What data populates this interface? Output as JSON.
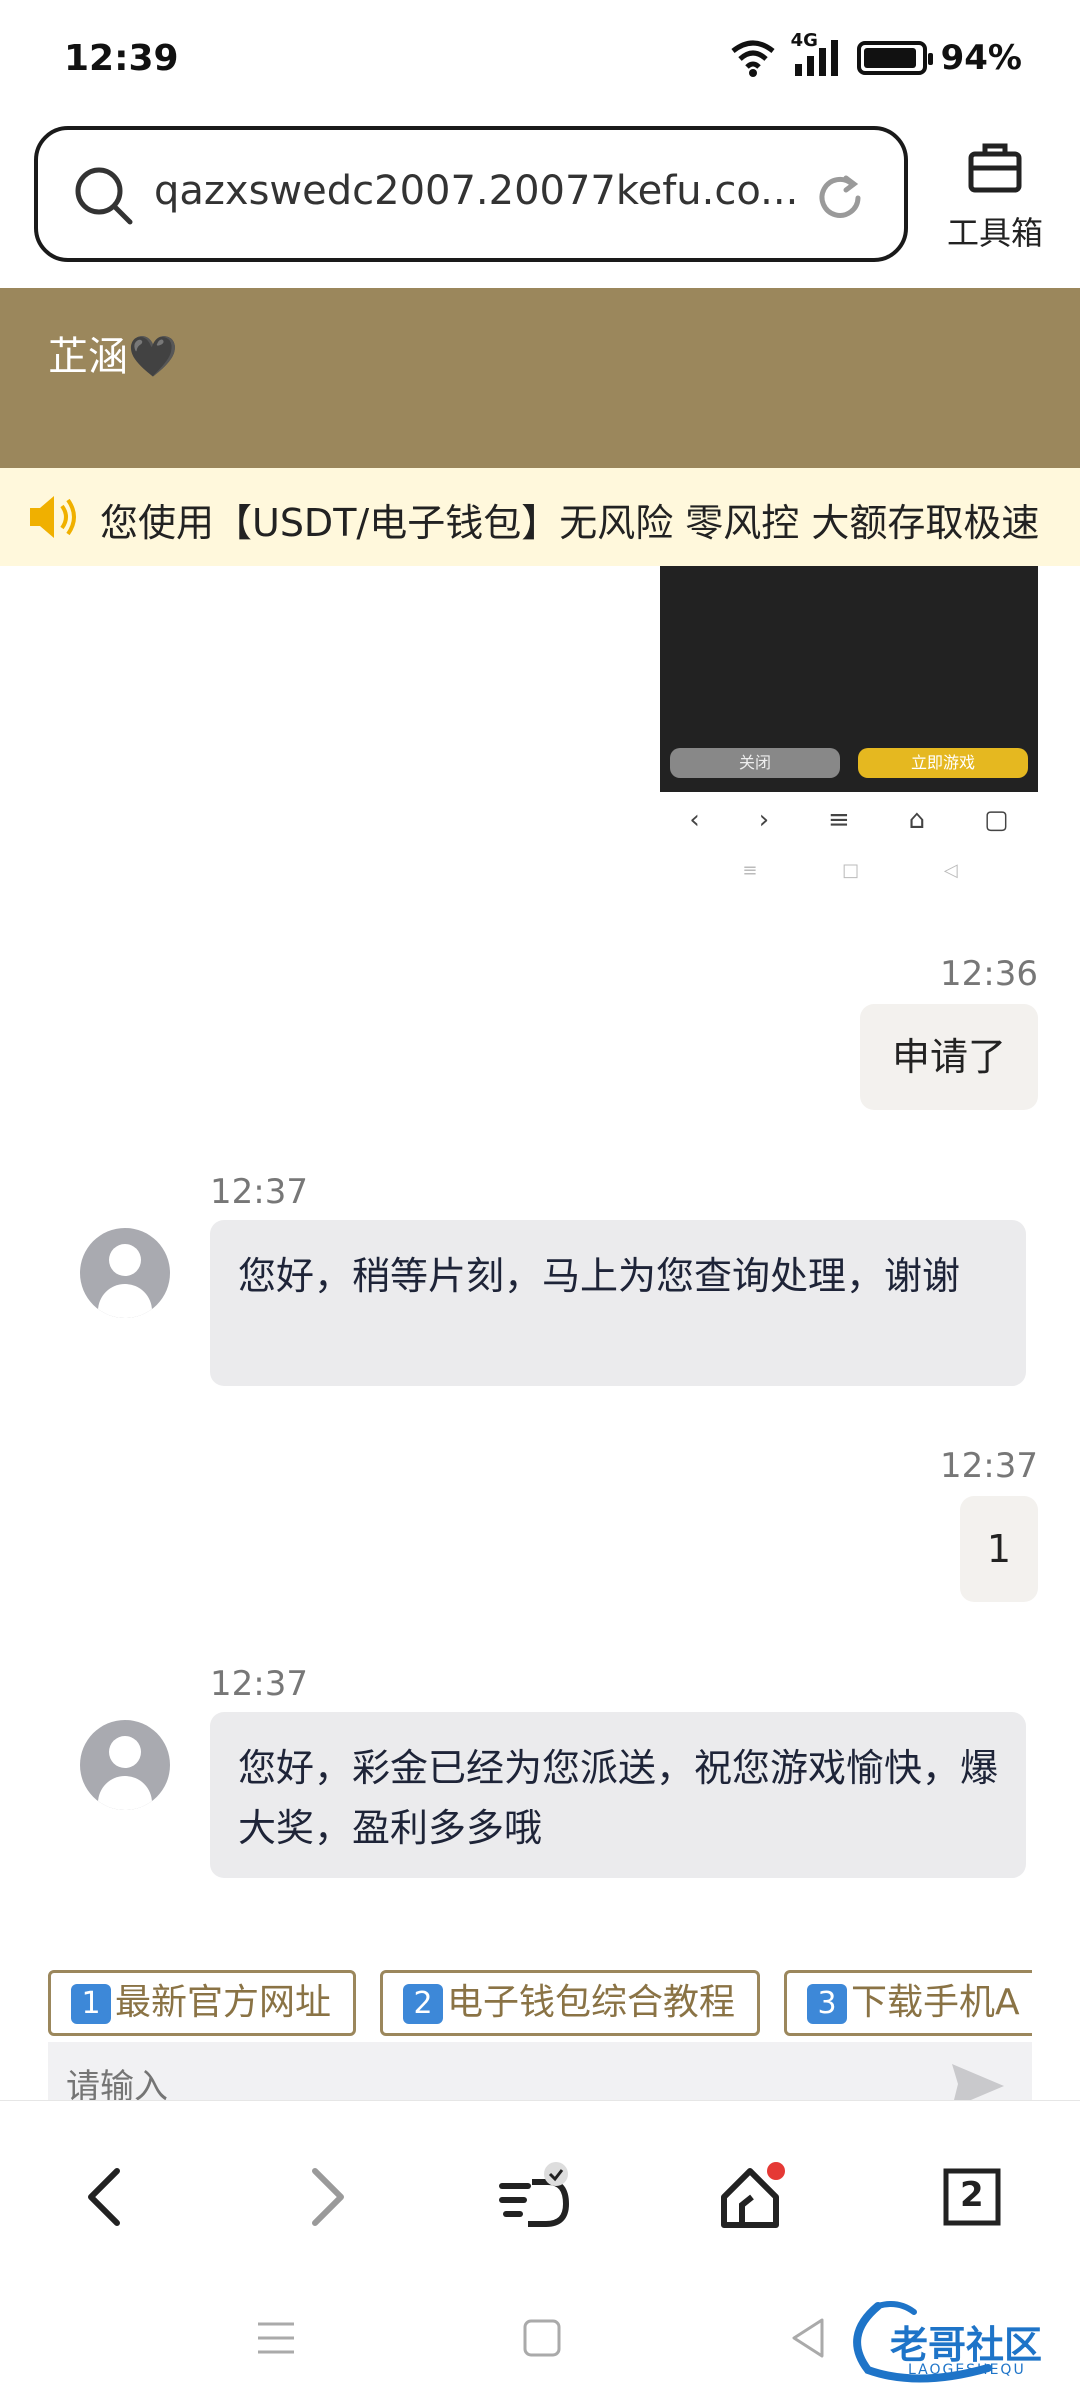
{
  "status": {
    "time": "12:39",
    "network": "4G",
    "battery": "94%",
    "battery_level": 0.94
  },
  "browser": {
    "url": "qazxswedc2007.20077kefu.co...",
    "toolbox_label": "工具箱"
  },
  "chat": {
    "agent_name": "芷涵🖤",
    "notice": "您使用【USDT/电子钱包】无风险 零风控 大额存取极速",
    "shared_image": {
      "left_button": "关闭",
      "right_button": "立即游戏"
    },
    "messages": [
      {
        "side": "right",
        "time": "12:36",
        "text": "申请了"
      },
      {
        "side": "left",
        "time": "12:37",
        "text": "您好，稍等片刻，马上为您查询处理，谢谢"
      },
      {
        "side": "right",
        "time": "12:37",
        "text": "1"
      },
      {
        "side": "left",
        "time": "12:37",
        "text": "您好，彩金已经为您派送，祝您游戏愉快，爆大奖，盈利多多哦"
      }
    ],
    "quick_buttons": [
      {
        "num": "1",
        "label": "最新官方网址"
      },
      {
        "num": "2",
        "label": "电子钱包综合教程"
      },
      {
        "num": "3",
        "label": "下载手机A"
      }
    ],
    "input_placeholder": "请输入"
  },
  "nav": {
    "tabs_count": "2"
  },
  "watermark": {
    "text": "老哥社区",
    "subtext": "LAOGESHEQU"
  },
  "colors": {
    "header": "#9b875c",
    "notice_bg": "#fff8dc",
    "accent_dot": "#e53935"
  }
}
